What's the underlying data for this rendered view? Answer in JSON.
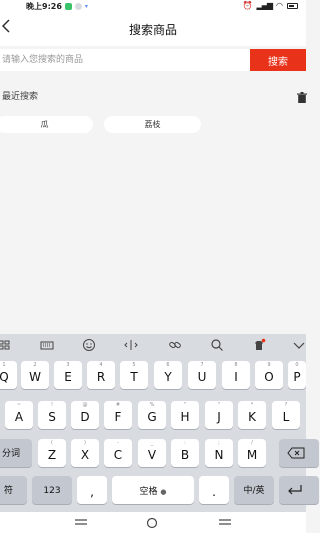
{
  "status_bar": {
    "time": "晚上9:26",
    "status_icons": [
      "app-notification-icon",
      "circle-icon",
      "arrow-icon"
    ],
    "right_icons": [
      "alarm-icon",
      "signal-icon",
      "wifi-icon",
      "battery-icon"
    ]
  },
  "header": {
    "title": "搜索商品",
    "back_icon": "chevron-left-icon"
  },
  "search": {
    "placeholder": "请输入您搜索的商品",
    "button_label": "搜索"
  },
  "recent": {
    "label": "最近搜索",
    "clear_icon": "trash-icon",
    "items": [
      {
        "label": "瓜"
      },
      {
        "label": "荔枝"
      }
    ]
  },
  "keyboard": {
    "toolbar_icons": [
      "grid-icon",
      "keyboard-icon",
      "emoji-icon",
      "cursor-icon",
      "link-icon",
      "search-icon",
      "skin-icon",
      "chevron-down-icon"
    ],
    "rows": [
      [
        {
          "key": "Q",
          "hint": "1"
        },
        {
          "key": "W",
          "hint": "2"
        },
        {
          "key": "E",
          "hint": "3"
        },
        {
          "key": "R",
          "hint": "4"
        },
        {
          "key": "T",
          "hint": "5"
        },
        {
          "key": "Y",
          "hint": "6"
        },
        {
          "key": "U",
          "hint": "7"
        },
        {
          "key": "I",
          "hint": "8"
        },
        {
          "key": "O",
          "hint": "9"
        },
        {
          "key": "P",
          "hint": "0"
        }
      ],
      [
        {
          "key": "A",
          "hint": "~"
        },
        {
          "key": "S",
          "hint": "!"
        },
        {
          "key": "D",
          "hint": "@"
        },
        {
          "key": "F",
          "hint": "#"
        },
        {
          "key": "G",
          "hint": "%"
        },
        {
          "key": "H",
          "hint": "\""
        },
        {
          "key": "J",
          "hint": "\""
        },
        {
          "key": "K",
          "hint": "*"
        },
        {
          "key": "L",
          "hint": "?"
        }
      ],
      [
        {
          "key": "Z",
          "hint": "("
        },
        {
          "key": "X",
          "hint": ")"
        },
        {
          "key": "C",
          "hint": "-"
        },
        {
          "key": "V",
          "hint": "_"
        },
        {
          "key": "B",
          "hint": ":"
        },
        {
          "key": "N",
          "hint": ";"
        },
        {
          "key": "M",
          "hint": "/"
        }
      ]
    ],
    "segment_label": "分词",
    "backspace_icon": "backspace-icon",
    "symbol_label": "符",
    "num_label": "123",
    "comma": ",",
    "space_label": "空格",
    "mic_icon": "microphone-icon",
    "period": ".",
    "lang_label": "中/英",
    "enter_icon": "enter-icon"
  },
  "system_nav": {
    "icons": [
      "menu-icon",
      "home-icon",
      "back-icon"
    ]
  }
}
